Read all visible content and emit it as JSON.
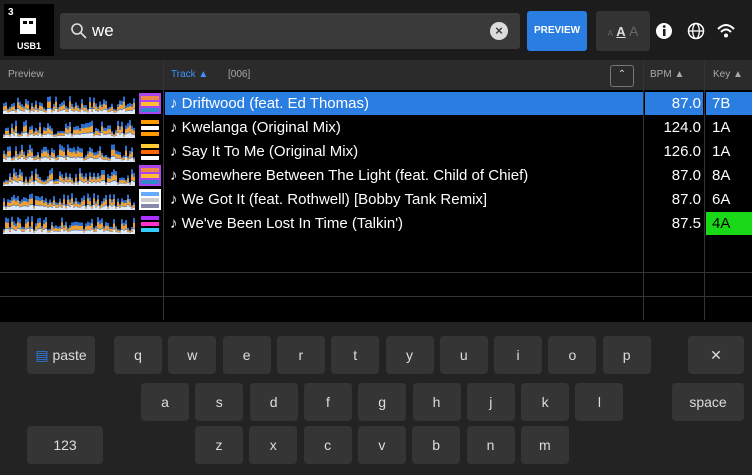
{
  "device": {
    "number": "3",
    "label": "USB1"
  },
  "search": {
    "value": "we",
    "placeholder": ""
  },
  "toolbar": {
    "preview_label": "PREVIEW",
    "font_small": "A",
    "font_mid": "A",
    "font_large": "A"
  },
  "header": {
    "preview": "Preview",
    "track": "Track ▲",
    "count": "[006]",
    "bpm": "BPM ▲",
    "key": "Key ▲"
  },
  "tracks": [
    {
      "title": "Driftwood (feat. Ed Thomas)",
      "bpm": "87.0",
      "key": "7B",
      "selected": true
    },
    {
      "title": "Kwelanga (Original Mix)",
      "bpm": "124.0",
      "key": "1A"
    },
    {
      "title": "Say It To Me (Original Mix)",
      "bpm": "126.0",
      "key": "1A"
    },
    {
      "title": "Somewhere Between The Light (feat. Child of Chief)",
      "bpm": "87.0",
      "key": "8A"
    },
    {
      "title": "We Got It (feat. Rothwell) [Bobby Tank Remix]",
      "bpm": "87.0",
      "key": "6A"
    },
    {
      "title": "We've Been Lost In Time (Talkin')",
      "bpm": "87.5",
      "key": "4A",
      "key_color": "#18d818"
    }
  ],
  "keyboard": {
    "paste": "paste",
    "row1": [
      "q",
      "w",
      "e",
      "r",
      "t",
      "y",
      "u",
      "i",
      "o",
      "p"
    ],
    "row2": [
      "a",
      "s",
      "d",
      "f",
      "g",
      "h",
      "j",
      "k",
      "l"
    ],
    "row3": [
      "z",
      "x",
      "c",
      "v",
      "b",
      "n",
      "m"
    ],
    "backspace": "✕",
    "space": "space",
    "numbers": "123"
  },
  "colors": {
    "accent": "#2a7de1",
    "key_green": "#18d818"
  }
}
